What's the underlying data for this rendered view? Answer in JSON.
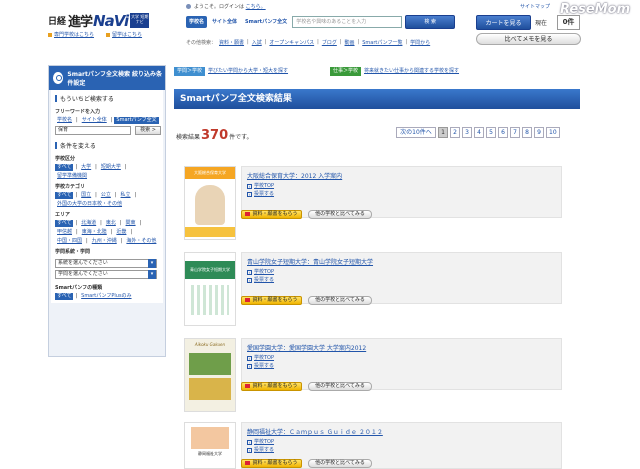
{
  "header": {
    "logo_nikkei": "日経",
    "logo_shingaku": "進学",
    "logo_navi": "NaVi",
    "logo_badge": "大学 短期 ナビ",
    "links": [
      "専門学校はこちら",
      "留学はこちら"
    ],
    "greeting": "ようこそ。ログインは",
    "greeting_link": "こちら。",
    "search_tabs": [
      "学校名",
      "サイト全体",
      "Smartパンフ全文"
    ],
    "search_placeholder": "学校名や興味のあることを入力",
    "search_button": "検 索",
    "sub_label": "その他検索：",
    "sub_links": [
      "資料・願書",
      "入試",
      "オープンキャンパス",
      "ブログ",
      "動画",
      "Smartパンフ一覧",
      "学問から"
    ],
    "sitemap": "サイトマップ",
    "cart_button": "カートを見る",
    "current_label": "現在",
    "cart_count": "0件",
    "compare_button": "比べてメモを見る",
    "watermark": "ReseMom"
  },
  "sidebar": {
    "head": "Smartパンフ全文検索 絞り込み条件設定",
    "section_refine": "もういちど検索する",
    "freeword_label": "フリーワードを入力",
    "scope_tags": [
      "学校名",
      "サイト全体",
      "Smartパンフ全文"
    ],
    "input_value": "保育",
    "search_btn": "検索 >",
    "section_conditions": "条件を変える",
    "school_type_label": "学校区分",
    "school_type_tags": [
      "すべて",
      "大学",
      "短期大学",
      "留学準備機関"
    ],
    "category_label": "学校カテゴリ",
    "category_tags": [
      "すべて",
      "国立",
      "公立",
      "私立",
      "外国の大学の日本校・その他"
    ],
    "area_label": "エリア",
    "area_tags": [
      "すべて",
      "北海道",
      "東北",
      "関東",
      "甲信越",
      "東海・北陸",
      "近畿",
      "中国・四国",
      "九州・沖縄",
      "海外・その他"
    ],
    "field_label": "学問系統・学問",
    "select1": "系統を選んでください",
    "select2": "学問を選んでください",
    "pamph_label": "Smartパンフの種類",
    "pamph_tags": [
      "すべて",
      "SmartパンフPlusのみ"
    ]
  },
  "main": {
    "crumb1_tag": "学問＞学校",
    "crumb1_text": "学びたい学問から大学・短大を探す",
    "crumb2_tag": "仕事＞学校",
    "crumb2_text": "将来就きたい仕事から関連する学校を探す",
    "title": "Smartパンフ全文検索結果",
    "results_label": "検索結果",
    "results_count": "370",
    "results_suffix": "件です。",
    "pager_next": "次の10件へ",
    "pager_pages": [
      "1",
      "2",
      "3",
      "4",
      "5",
      "6",
      "7",
      "8",
      "9",
      "10"
    ],
    "pager_current": "1",
    "items": [
      {
        "title": "大阪総合保育大学：2012 入学案内",
        "link1": "学校TOP",
        "link2": "投票する",
        "btn1": "資料・願書をもらう",
        "btn2": "他の学校と比べてみる",
        "thumb_text": "大阪総合保育大学"
      },
      {
        "title": "青山学院女子短期大学：青山学院女子短期大学",
        "link1": "学校TOP",
        "link2": "投票する",
        "btn1": "資料・願書をもらう",
        "btn2": "他の学校と比べてみる",
        "thumb_text": "青山学院女子短期大学"
      },
      {
        "title": "愛国学園大学：愛国学園大学 大学案内2012",
        "link1": "学校TOP",
        "link2": "投票する",
        "btn1": "資料・願書をもらう",
        "btn2": "他の学校と比べてみる",
        "thumb_text": "Aikoku Gakuen"
      },
      {
        "title": "静岡福祉大学：Ｃａｍｐｕｓ Ｇｕｉｄｅ ２０１２",
        "link1": "学校TOP",
        "link2": "投票する",
        "btn1": "資料・願書をもらう",
        "btn2": "他の学校と比べてみる",
        "thumb_text": "静岡福祉大学"
      }
    ]
  },
  "colors": {
    "accent_blue": "#2a63b3",
    "result_red": "#c0392b",
    "button_yellow": "#f0b400"
  }
}
